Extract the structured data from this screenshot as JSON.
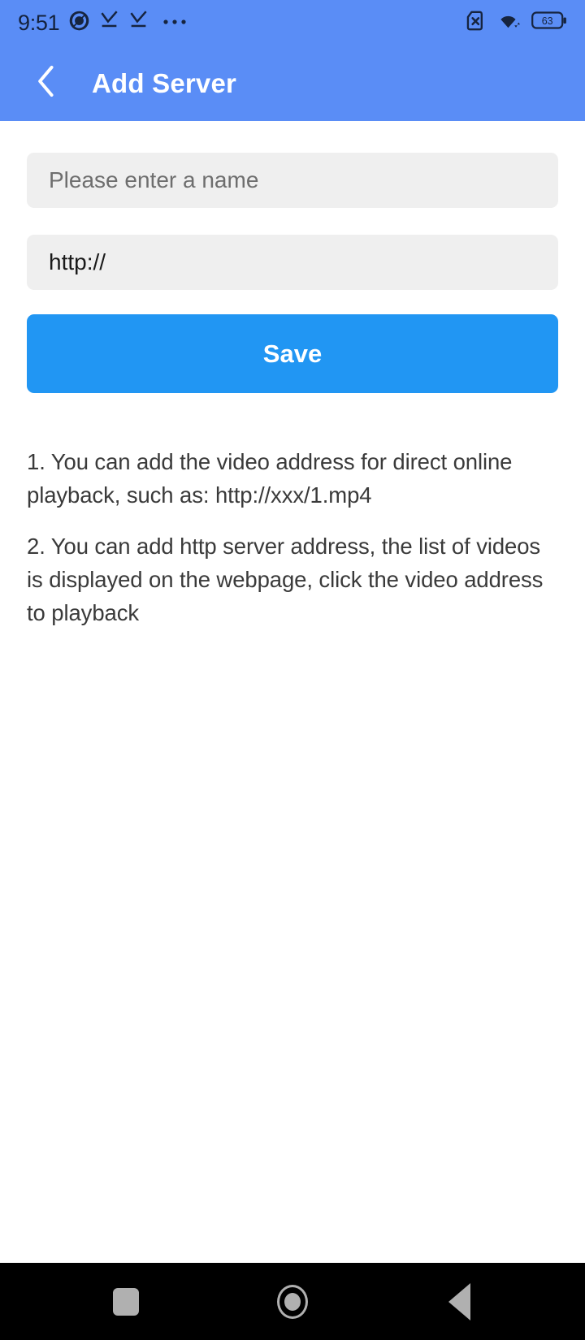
{
  "status_bar": {
    "time": "9:51",
    "left_icons": [
      "app-circle-icon",
      "download-complete-icon",
      "download-complete-icon",
      "overflow-dots-icon"
    ],
    "right_icons": [
      "sim-card-missing-icon",
      "wifi-icon",
      "battery-icon"
    ],
    "battery_level": "63",
    "background_color": "#5A8DF6"
  },
  "app_bar": {
    "back_icon": "chevron-left-icon",
    "title": "Add Server",
    "background_color": "#5A8DF6",
    "title_color": "#FFFFFF"
  },
  "form": {
    "name_field": {
      "value": "",
      "placeholder": "Please enter a name"
    },
    "url_field": {
      "value": "http://",
      "placeholder": "http://"
    },
    "save_label": "Save",
    "save_color": "#2196F3",
    "field_background": "#EFEFEF"
  },
  "notes": [
    "1. You can add the video address for direct online playback, such as: http://xxx/1.mp4",
    "2. You can add http server address, the list of videos is displayed on the webpage, click the video address to playback"
  ],
  "nav_bar": {
    "recents_label": "recents-button",
    "home_label": "home-button",
    "back_label": "back-button",
    "background_color": "#000000",
    "icon_color": "#B0B0B0"
  }
}
